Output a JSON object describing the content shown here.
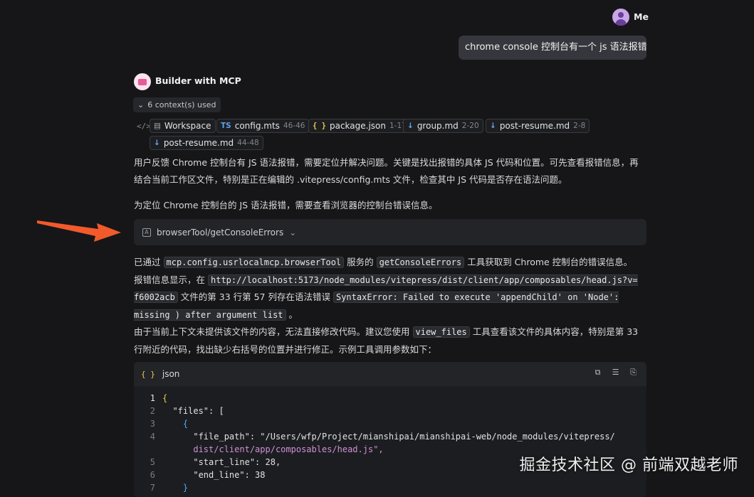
{
  "user": {
    "name": "Me",
    "message": "chrome console 控制台有一个 js 语法报错"
  },
  "assistant": {
    "name": "Builder with MCP"
  },
  "context": {
    "toggle_label": "6 context(s) used",
    "items": [
      {
        "icon": "workspace-icon",
        "name": "Workspace",
        "range": ""
      },
      {
        "icon": "typescript-file-icon",
        "badge": "TS",
        "name": "config.mts",
        "range": "46-46"
      },
      {
        "icon": "json-file-icon",
        "badge": "{ }",
        "name": "package.json",
        "range": "1-17"
      },
      {
        "icon": "markdown-file-icon",
        "badge": "↓",
        "name": "group.md",
        "range": "2-20"
      },
      {
        "icon": "markdown-file-icon",
        "badge": "↓",
        "name": "post-resume.md",
        "range": "2-8"
      },
      {
        "icon": "markdown-file-icon",
        "badge": "↓",
        "name": "post-resume.md",
        "range": "44-48"
      }
    ]
  },
  "text": {
    "intro_1": "用户反馈 Chrome 控制台有 JS 语法报错，需要定位并解决问题。关键是找出报错的具体 JS 代码和位置。可先查看报错信息，再结合当前工作区文件，特别是正在编辑的 .vitepress/config.mts 文件，检查其中 JS 代码是否存在语法问题。",
    "intro_2": "为定位 Chrome 控制台的 JS 语法报错，需要查看浏览器的控制台错误信息。",
    "tool_call": "browserTool/getConsoleErrors",
    "result_a": "已通过",
    "result_code_1": "mcp.config.usrlocalmcp.browserTool",
    "result_b": "服务的",
    "result_code_2": "getConsoleErrors",
    "result_c": "工具获取到 Chrome 控制台的错误信息。报错信息显示，在",
    "result_code_3": "http://localhost:5173/node_modules/vitepress/dist/client/app/composables/head.js?v=f6002acb",
    "result_d": "文件的第 33 行第 57 列存在语法错误",
    "result_code_4": "SyntaxError: Failed to execute 'appendChild' on 'Node': missing ) after argument list",
    "result_e": "。",
    "result_f": "由于当前上下文未提供该文件的内容，无法直接修改代码。建议您使用",
    "result_code_5": "view_files",
    "result_g": "工具查看该文件的具体内容，特别是第 33 行附近的代码，找出缺少右括号的位置并进行修正。示例工具调用参数如下："
  },
  "code_block": {
    "language": "json",
    "lines": [
      {
        "no": "1",
        "text": "{"
      },
      {
        "no": "2",
        "text": "  \"files\": ["
      },
      {
        "no": "3",
        "text": "    {"
      },
      {
        "no": "4",
        "text": "      \"file_path\": \"/Users/wfp/Project/mianshipai/mianshipai-web/node_modules/vitepress/"
      },
      {
        "no": "",
        "text": "      dist/client/app/composables/head.js\","
      },
      {
        "no": "5",
        "text": "      \"start_line\": 28,"
      },
      {
        "no": "6",
        "text": "      \"end_line\": 38"
      },
      {
        "no": "7",
        "text": "    }"
      }
    ]
  },
  "watermark": "掘金技术社区 @ 前端双越老师",
  "colors": {
    "background": "#161618",
    "arrow": "#f25a2c",
    "bubble": "#36373c"
  }
}
